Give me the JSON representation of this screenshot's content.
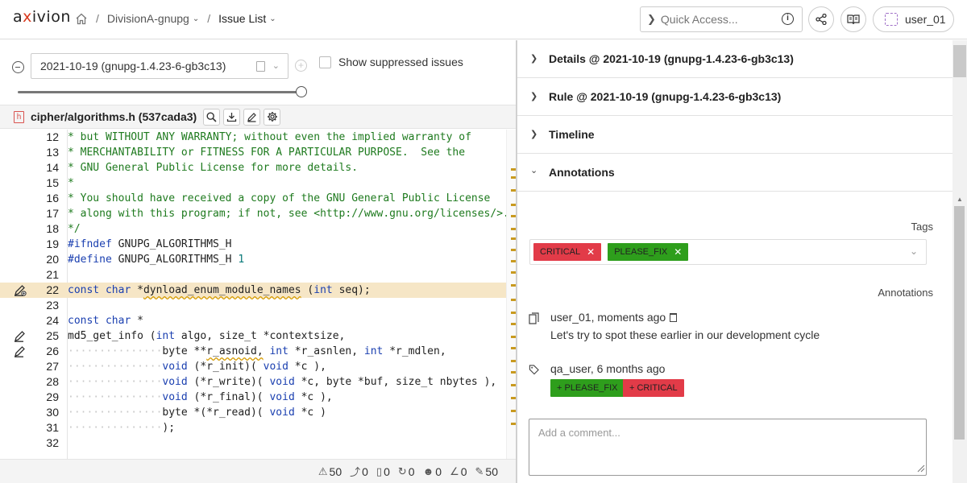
{
  "header": {
    "logo": "axivion",
    "breadcrumb": {
      "project": "DivisionA-gnupg",
      "page": "Issue List"
    },
    "quick_access_placeholder": "Quick Access...",
    "user": "user_01"
  },
  "left": {
    "version": "2021-10-19 (gnupg-1.4.23-6-gb3c13)",
    "show_suppressed_label": "Show suppressed issues",
    "file": "cipher/algorithms.h (537cada3)",
    "code_lines": [
      {
        "n": "12",
        "t": "* but WITHOUT ANY WARRANTY; without even the implied warranty of"
      },
      {
        "n": "13",
        "t": "* MERCHANTABILITY or FITNESS FOR A PARTICULAR PURPOSE.  See the"
      },
      {
        "n": "14",
        "t": "* GNU General Public License for more details."
      },
      {
        "n": "15",
        "t": "*"
      },
      {
        "n": "16",
        "t": "* You should have received a copy of the GNU General Public License"
      },
      {
        "n": "17",
        "t": "* along with this program; if not, see <http://www.gnu.org/licenses/>."
      },
      {
        "n": "18",
        "t": "*/"
      },
      {
        "n": "19",
        "t": "#ifndef GNUPG_ALGORITHMS_H"
      },
      {
        "n": "20",
        "t": "#define GNUPG_ALGORITHMS_H 1"
      },
      {
        "n": "21",
        "t": ""
      },
      {
        "n": "22",
        "t": "const char *dynload_enum_module_names (int seq);"
      },
      {
        "n": "23",
        "t": ""
      },
      {
        "n": "24",
        "t": "const char *"
      },
      {
        "n": "25",
        "t": "md5_get_info (int algo, size_t *contextsize,"
      },
      {
        "n": "26",
        "t": "byte **r_asnoid, int *r_asnlen, int *r_mdlen,"
      },
      {
        "n": "27",
        "t": "void (*r_init)( void *c ),"
      },
      {
        "n": "28",
        "t": "void (*r_write)( void *c, byte *buf, size_t nbytes ),"
      },
      {
        "n": "29",
        "t": "void (*r_final)( void *c ),"
      },
      {
        "n": "30",
        "t": "byte *(*r_read)( void *c )"
      },
      {
        "n": "31",
        "t": ");"
      },
      {
        "n": "32",
        "t": ""
      }
    ],
    "status": {
      "warnings": "50",
      "s2": "0",
      "s3": "0",
      "s4": "0",
      "s5": "0",
      "s6": "0",
      "annotations": "50"
    }
  },
  "right": {
    "sections": {
      "details": "Details @ 2021-10-19 (gnupg-1.4.23-6-gb3c13)",
      "rule": "Rule @ 2021-10-19 (gnupg-1.4.23-6-gb3c13)",
      "timeline": "Timeline",
      "annotations": "Annotations"
    },
    "tags_label": "Tags",
    "tags": [
      {
        "label": "CRITICAL",
        "color": "#e23b48"
      },
      {
        "label": "PLEASE_FIX",
        "color": "#2e9e1c"
      }
    ],
    "annotations_label": "Annotations",
    "entries": [
      {
        "header": "user_01, moments ago",
        "text": "Let's try to spot these earlier in our development cycle"
      },
      {
        "header": "qa_user, 6 months ago",
        "chips": [
          "+ PLEASE_FIX",
          "+ CRITICAL"
        ]
      }
    ],
    "comment_placeholder": "Add a comment..."
  }
}
